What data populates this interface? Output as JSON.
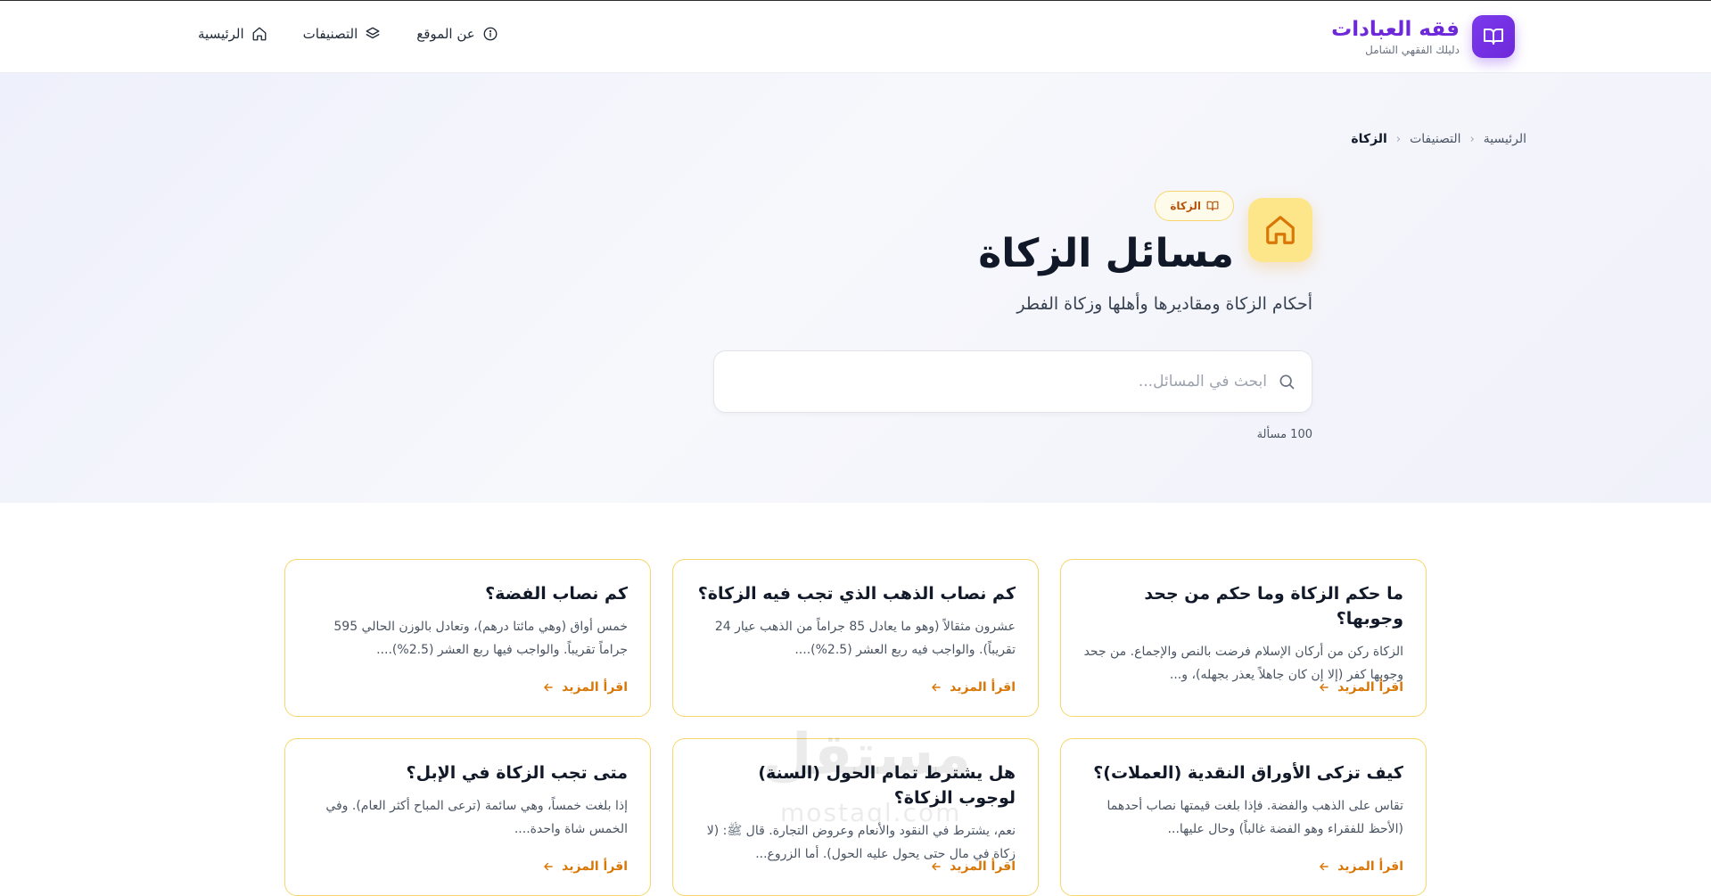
{
  "brand": {
    "title": "فقه العبادات",
    "subtitle": "دليلك الفقهي الشامل"
  },
  "nav": {
    "home": "الرئيسية",
    "categories": "التصنيفات",
    "about": "عن الموقع"
  },
  "breadcrumb": {
    "home": "الرئيسية",
    "categories": "التصنيفات",
    "current": "الزكاة"
  },
  "category": {
    "badge": "الزكاة",
    "title": "مسائل الزكاة",
    "description": "أحكام الزكاة ومقاديرها وأهلها وزكاة الفطر",
    "count_text": "100 مسألة",
    "accent_color": "#f59e0b",
    "icon": "home-icon"
  },
  "search": {
    "placeholder": "ابحث في المسائل...",
    "value": ""
  },
  "cards": [
    {
      "title": "ما حكم الزكاة وما حكم من جحد وجوبها؟",
      "excerpt": "الزكاة ركن من أركان الإسلام فرضت بالنص والإجماع. من جحد وجوبها كفر (إلا إن كان جاهلاً يعذر بجهله)، و...",
      "more": "اقرأ المزيد"
    },
    {
      "title": "كم نصاب الذهب الذي تجب فيه الزكاة؟",
      "excerpt": "عشرون مثقالاً (وهو ما يعادل 85 جراماً من الذهب عيار 24 تقريباً). والواجب فيه ربع العشر (2.5%)....",
      "more": "اقرأ المزيد"
    },
    {
      "title": "كم نصاب الفضة؟",
      "excerpt": "خمس أواق (وهي مائتا درهم)، وتعادل بالوزن الحالي 595 جراماً تقريباً. والواجب فيها ربع العشر (2.5%)....",
      "more": "اقرأ المزيد"
    },
    {
      "title": "كيف تزكى الأوراق النقدية (العملات)؟",
      "excerpt": "تقاس على الذهب والفضة. فإذا بلغت قيمتها نصاب أحدهما (الأحظ للفقراء وهو الفضة غالباً) وحال عليها...",
      "more": "اقرأ المزيد"
    },
    {
      "title": "هل يشترط تمام الحول (السنة) لوجوب الزكاة؟",
      "excerpt": "نعم، يشترط في النقود والأنعام وعروض التجارة. قال ﷺ: (لا زكاة في مال حتى يحول عليه الحول). أما الزروع...",
      "more": "اقرأ المزيد"
    },
    {
      "title": "متى تجب الزكاة في الإبل؟",
      "excerpt": "إذا بلغت خمساً، وهي سائمة (ترعى المباح أكثر العام). وفي الخمس شاة واحدة....",
      "more": "اقرأ المزيد"
    }
  ],
  "watermark": {
    "text": "مستقل",
    "sub": "mostaql.com"
  }
}
